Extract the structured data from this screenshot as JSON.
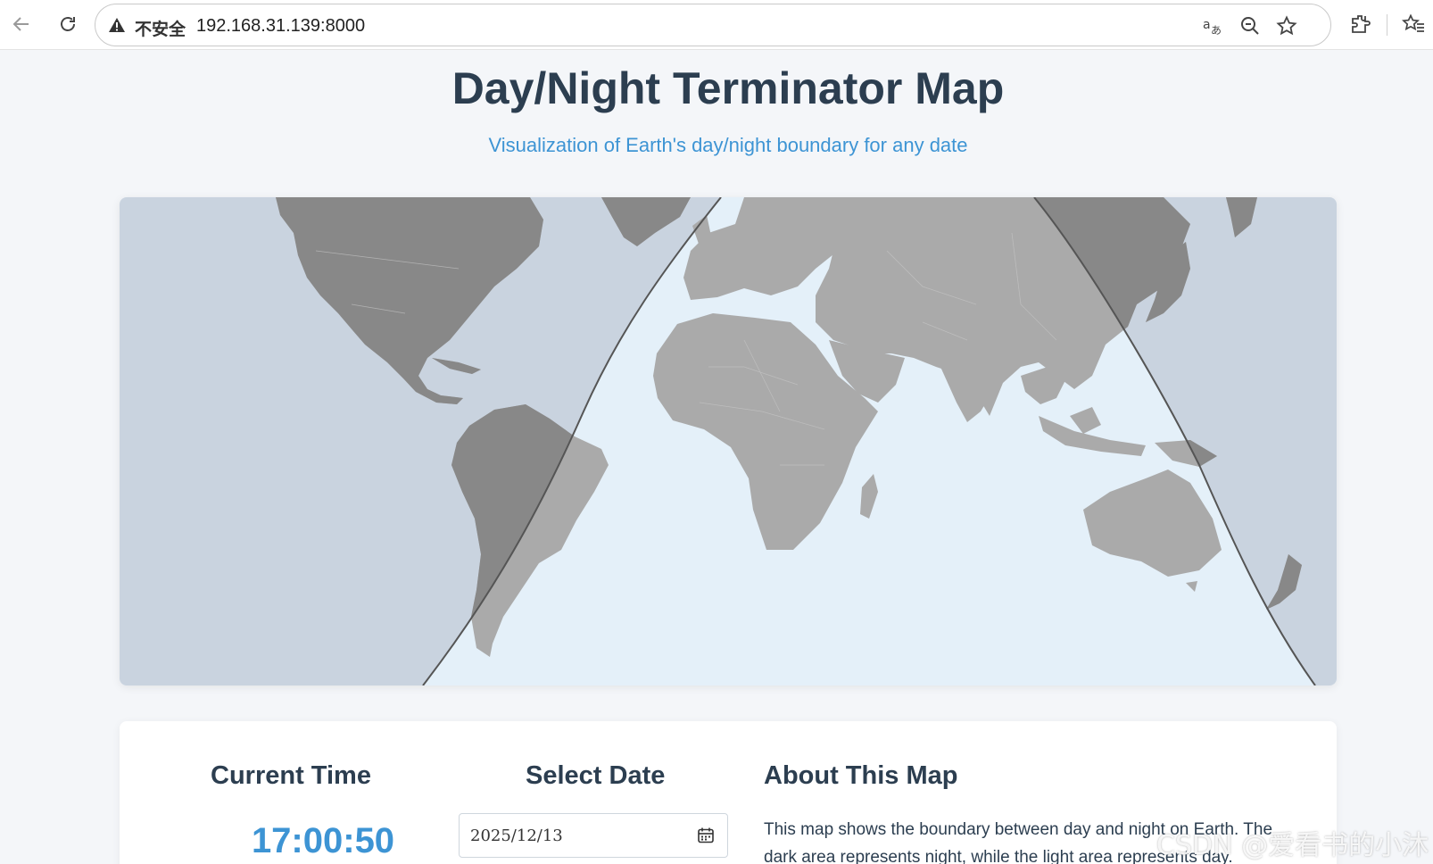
{
  "browser": {
    "security_label": "不安全",
    "url": "192.168.31.139:8000",
    "icons": [
      "back-arrow-icon",
      "reload-icon",
      "warning-icon",
      "translate-icon",
      "zoom-out-icon",
      "bookmark-star-icon",
      "extensions-icon",
      "favorites-icon"
    ]
  },
  "header": {
    "title": "Day/Night Terminator Map",
    "subtitle": "Visualization of Earth's day/night boundary for any date"
  },
  "map": {
    "colors": {
      "ocean_day": "#e4f0f9",
      "ocean_night": "#c9d3df",
      "land_day": "#aaaaaa",
      "land_night": "#888888",
      "terminator_line": "#555555"
    }
  },
  "panel": {
    "current_time": {
      "heading": "Current Time",
      "value": "17:00:50"
    },
    "select_date": {
      "heading": "Select Date",
      "value": "2025/12/13"
    },
    "about": {
      "heading": "About This Map",
      "text": "This map shows the boundary between day and night on Earth. The dark area represents night, while the light area represents day."
    }
  },
  "watermark": "CSDN @爱看书的小沐",
  "colors": {
    "accent": "#3d94d4",
    "heading": "#2c3e50",
    "page_bg": "#f4f6f9"
  }
}
